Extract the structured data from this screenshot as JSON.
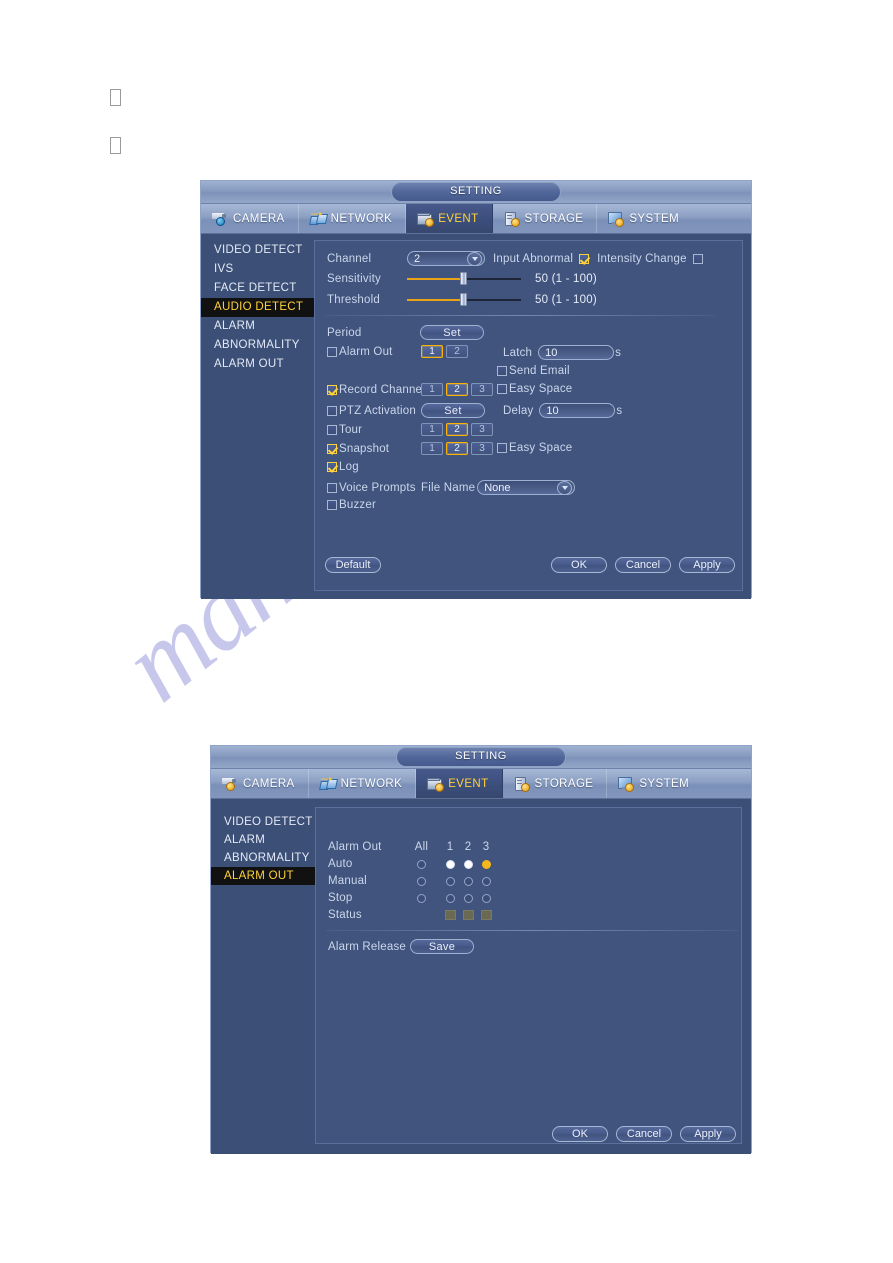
{
  "page": {
    "glyph_placeholders": [
      "",
      ""
    ]
  },
  "watermark": {
    "text": "manualshive.com"
  },
  "dialog_one": {
    "title": "SETTING",
    "tabs": [
      {
        "label": "CAMERA",
        "icon": "camera-icon",
        "active": false
      },
      {
        "label": "NETWORK",
        "icon": "network-icon",
        "active": false
      },
      {
        "label": "EVENT",
        "icon": "event-icon",
        "active": true
      },
      {
        "label": "STORAGE",
        "icon": "storage-icon",
        "active": false
      },
      {
        "label": "SYSTEM",
        "icon": "system-icon",
        "active": false
      }
    ],
    "sidebar": [
      {
        "label": "VIDEO DETECT",
        "active": false
      },
      {
        "label": "IVS",
        "active": false
      },
      {
        "label": "FACE DETECT",
        "active": false
      },
      {
        "label": "AUDIO DETECT",
        "active": true
      },
      {
        "label": "ALARM",
        "active": false
      },
      {
        "label": "ABNORMALITY",
        "active": false
      },
      {
        "label": "ALARM OUT",
        "active": false
      }
    ],
    "fields": {
      "channel_label": "Channel",
      "channel_value": "2",
      "input_abnormal_label": "Input Abnormal",
      "input_abnormal_checked": true,
      "intensity_change_label": "Intensity Change",
      "intensity_change_checked": false,
      "sensitivity_label": "Sensitivity",
      "sensitivity_value": "50 (1 - 100)",
      "sensitivity_percent": 50,
      "threshold_label": "Threshold",
      "threshold_value": "50 (1 - 100)",
      "threshold_percent": 50,
      "period_label": "Period",
      "period_button": "Set",
      "alarm_out_label": "Alarm Out",
      "alarm_out_checked": false,
      "alarm_out_channels": [
        {
          "label": "1",
          "selected": true
        },
        {
          "label": "2",
          "selected": false
        }
      ],
      "latch_label": "Latch",
      "latch_value": "10",
      "latch_unit": "s",
      "send_email_label": "Send Email",
      "send_email_checked": false,
      "record_channel_label": "Record Channel",
      "record_channel_checked": true,
      "record_channels": [
        {
          "label": "1",
          "selected": false
        },
        {
          "label": "2",
          "selected": true
        },
        {
          "label": "3",
          "selected": false
        }
      ],
      "easy_space_1_label": "Easy Space",
      "easy_space_1_checked": false,
      "ptz_activation_label": "PTZ Activation",
      "ptz_activation_checked": false,
      "ptz_button": "Set",
      "delay_label": "Delay",
      "delay_value": "10",
      "delay_unit": "s",
      "tour_label": "Tour",
      "tour_checked": false,
      "tour_channels": [
        {
          "label": "1",
          "selected": false
        },
        {
          "label": "2",
          "selected": true
        },
        {
          "label": "3",
          "selected": false
        }
      ],
      "snapshot_label": "Snapshot",
      "snapshot_checked": true,
      "snapshot_channels": [
        {
          "label": "1",
          "selected": false
        },
        {
          "label": "2",
          "selected": true
        },
        {
          "label": "3",
          "selected": false
        }
      ],
      "easy_space_2_label": "Easy Space",
      "easy_space_2_checked": false,
      "log_label": "Log",
      "log_checked": true,
      "voice_prompts_label": "Voice Prompts",
      "voice_prompts_checked": false,
      "file_name_label": "File Name",
      "file_name_value": "None",
      "buzzer_label": "Buzzer",
      "buzzer_checked": false
    },
    "footer": {
      "default_label": "Default",
      "ok_label": "OK",
      "cancel_label": "Cancel",
      "apply_label": "Apply"
    }
  },
  "dialog_two": {
    "title": "SETTING",
    "tabs": [
      {
        "label": "CAMERA",
        "icon": "camera-icon",
        "active": false
      },
      {
        "label": "NETWORK",
        "icon": "network-icon",
        "active": false
      },
      {
        "label": "EVENT",
        "icon": "event-icon",
        "active": true
      },
      {
        "label": "STORAGE",
        "icon": "storage-icon",
        "active": false
      },
      {
        "label": "SYSTEM",
        "icon": "system-icon",
        "active": false
      }
    ],
    "sidebar": [
      {
        "label": "VIDEO DETECT",
        "active": false
      },
      {
        "label": "ALARM",
        "active": false
      },
      {
        "label": "ABNORMALITY",
        "active": false
      },
      {
        "label": "ALARM OUT",
        "active": true
      }
    ],
    "alarm_out": {
      "header_label": "Alarm Out",
      "all_label": "All",
      "channel_headers": [
        "1",
        "2",
        "3"
      ],
      "rows": [
        {
          "label": "Auto",
          "all": "off",
          "channels": [
            "on",
            "on",
            "amber"
          ]
        },
        {
          "label": "Manual",
          "all": "off",
          "channels": [
            "off",
            "off",
            "off"
          ]
        },
        {
          "label": "Stop",
          "all": "off",
          "channels": [
            "off",
            "off",
            "off"
          ]
        }
      ],
      "status_label": "Status",
      "status_boxes": [
        "dim",
        "dim",
        "dim"
      ],
      "alarm_release_label": "Alarm Release",
      "save_label": "Save"
    },
    "footer": {
      "ok_label": "OK",
      "cancel_label": "Cancel",
      "apply_label": "Apply"
    }
  },
  "colors": {
    "dialog_bg": "#3c4f76",
    "accent_gold": "#ffd23a",
    "slider_fill": "#e8a317",
    "panel_border": "#5a6f9c"
  }
}
